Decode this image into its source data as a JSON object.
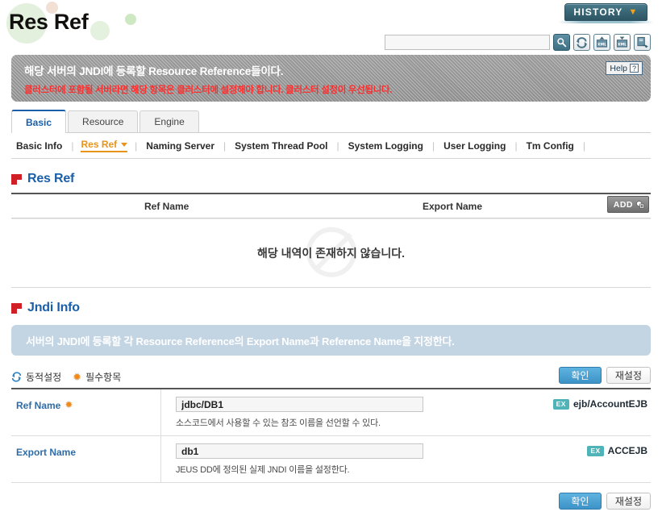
{
  "header": {
    "logo_text": "Res Ref",
    "history_label": "HISTORY",
    "history_caret": "chevron-down-icon",
    "search_value": "",
    "search_placeholder": "",
    "tools": [
      {
        "name": "search-icon",
        "title": "Search"
      },
      {
        "name": "refresh-icon",
        "title": "Reload"
      },
      {
        "name": "xml-export-icon",
        "title": "Export XML"
      },
      {
        "name": "xml-import-icon",
        "title": "Import XML"
      },
      {
        "name": "backup-icon",
        "title": "Backup"
      }
    ]
  },
  "banner": {
    "line1": "해당 서버의 JNDI에 등록할 Resource Reference들이다.",
    "line2": "클러스터에 포함될 서버라면 해당 항목은 클러스터에 설정해야 합니다. 클러스터 설정이 우선됩니다.",
    "help_label": "Help",
    "help_mark": "?"
  },
  "tabs": [
    {
      "label": "Basic",
      "active": true
    },
    {
      "label": "Resource",
      "active": false
    },
    {
      "label": "Engine",
      "active": false
    }
  ],
  "submenu": [
    {
      "label": "Basic Info",
      "active": false
    },
    {
      "label": "Res Ref",
      "active": true
    },
    {
      "label": "Naming Server",
      "active": false
    },
    {
      "label": "System Thread Pool",
      "active": false
    },
    {
      "label": "System Logging",
      "active": false
    },
    {
      "label": "User Logging",
      "active": false
    },
    {
      "label": "Tm Config",
      "active": false
    }
  ],
  "resref_section": {
    "title": "Res Ref",
    "columns": {
      "ref_name": "Ref Name",
      "export_name": "Export Name"
    },
    "add_label": "ADD",
    "rows": [],
    "empty_message": "해당 내역이 존재하지 않습니다."
  },
  "jndi_section": {
    "title": "Jndi Info",
    "info_text": "서버의 JNDI에 등록할 각 Resource Reference의 Export Name과 Reference Name을 지정한다.",
    "legend": {
      "dynamic_label": "동적설정",
      "required_label": "필수항목",
      "required_star": "✹"
    },
    "buttons": {
      "confirm": "확인",
      "reset": "재설정"
    },
    "fields": [
      {
        "label": "Ref Name",
        "required": true,
        "value": "jdbc/DB1",
        "help": "소스코드에서 사용할 수 있는 참조 이름을 선언할 수 있다.",
        "example_badge": "EX",
        "example_value": "ejb/AccountEJB"
      },
      {
        "label": "Export Name",
        "required": false,
        "value": "db1",
        "help": "JEUS DD에 정의된 실제 JNDI 이름을 설정한다.",
        "example_badge": "EX",
        "example_value": "ACCEJB"
      }
    ]
  },
  "colors": {
    "accent_blue": "#1a5fa8",
    "accent_orange": "#e8941a",
    "required_orange": "#f08a1c",
    "alert_red": "#ff2e2e",
    "section_red": "#d21f26",
    "example_teal": "#4fb3b8",
    "primary_button": "#3d93c7",
    "info_bar": "#c3d4e3",
    "banner_gray": "#8e8e8e"
  }
}
